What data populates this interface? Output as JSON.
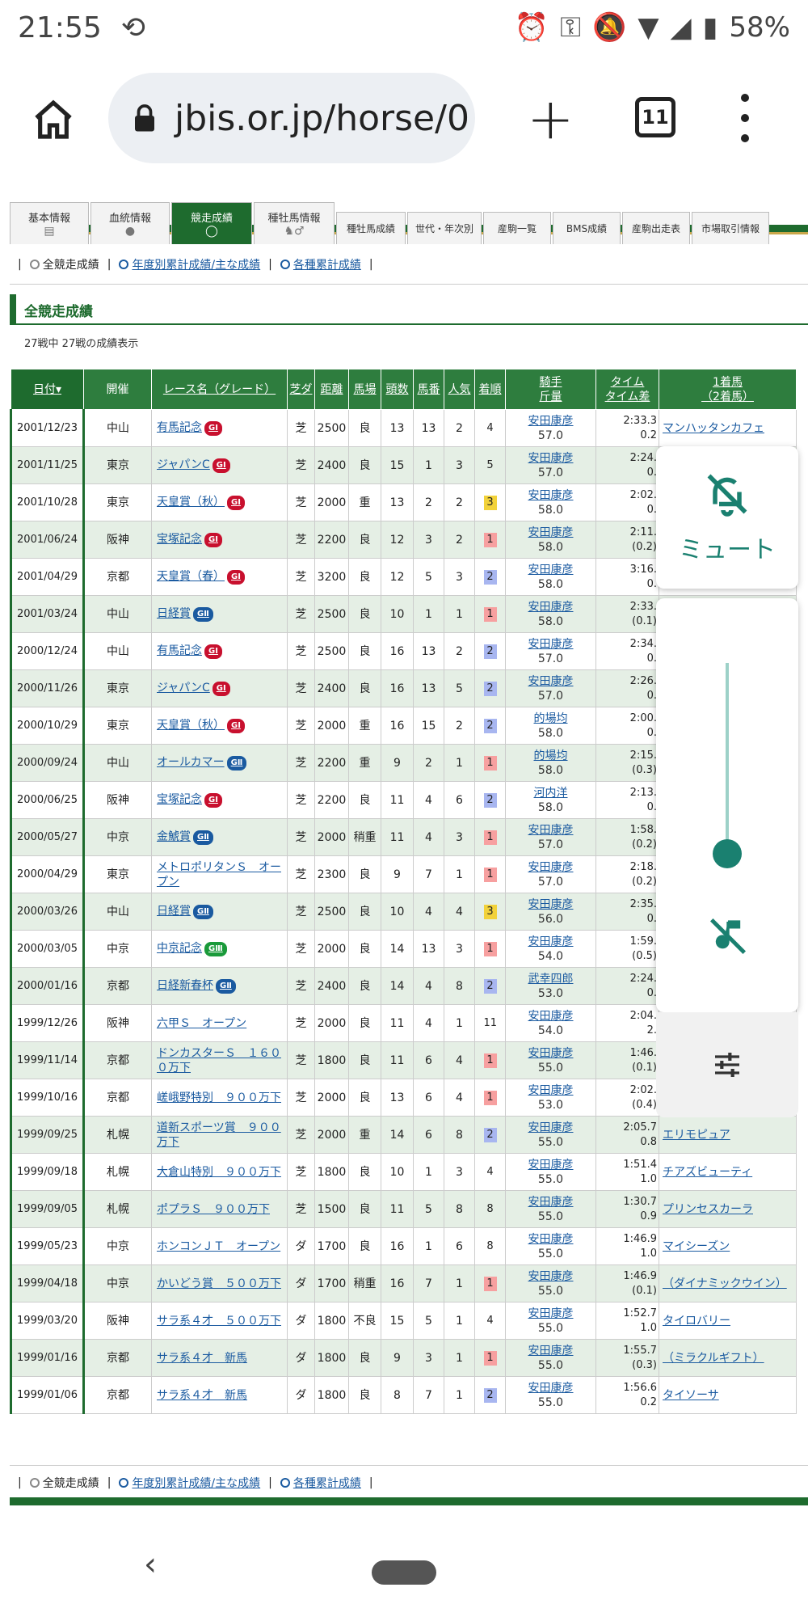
{
  "status": {
    "time": "21:55",
    "battery": "58%"
  },
  "browser": {
    "url": "jbis.or.jp/horse/0",
    "tab_count": "11"
  },
  "nav_tabs": [
    "基本情報",
    "血統情報",
    "競走成績",
    "種牡馬情報",
    "種牡馬成績",
    "世代・年次別",
    "産駒一覧",
    "BMS成績",
    "産駒出走表",
    "市場取引情報"
  ],
  "sublinks": [
    "全競走成績",
    "年度別累計成績/主な成績",
    "各種累計成績"
  ],
  "section_title": "全競走成績",
  "count_text": "27戦中 27戦の成績表示",
  "headers": {
    "date": "日付▾",
    "venue": "開催",
    "race": "レース名（グレード）",
    "surface": "芝ダ",
    "distance": "距離",
    "track": "馬場",
    "runners": "頭数",
    "number": "馬番",
    "pop": "人気",
    "place": "着順",
    "jockey": "騎手",
    "weight": "斤量",
    "time": "タイム",
    "diff": "タイム差",
    "winner": "1着馬",
    "second": "（2着馬）"
  },
  "rows": [
    {
      "date": "2001/12/23",
      "venue": "中山",
      "race": "有馬記念",
      "grade": "G1",
      "surface": "芝",
      "dist": "2500",
      "track": "良",
      "runners": "13",
      "num": "13",
      "pop": "2",
      "place": "4",
      "jockey": "安田康彦",
      "weight": "57.0",
      "time": "2:33.3",
      "diff": "0.2",
      "winner": "マンハッタンカフェ"
    },
    {
      "date": "2001/11/25",
      "venue": "東京",
      "race": "ジャパンC",
      "grade": "G1",
      "surface": "芝",
      "dist": "2400",
      "track": "良",
      "runners": "15",
      "num": "1",
      "pop": "3",
      "place": "5",
      "jockey": "安田康彦",
      "weight": "57.0",
      "time": "2:24.",
      "diff": "0.",
      "winner": ""
    },
    {
      "date": "2001/10/28",
      "venue": "東京",
      "race": "天皇賞（秋）",
      "grade": "G1",
      "surface": "芝",
      "dist": "2000",
      "track": "重",
      "runners": "13",
      "num": "2",
      "pop": "2",
      "place": "3",
      "jockey": "安田康彦",
      "weight": "58.0",
      "time": "2:02.",
      "diff": "0.",
      "winner": ""
    },
    {
      "date": "2001/06/24",
      "venue": "阪神",
      "race": "宝塚記念",
      "grade": "G1",
      "surface": "芝",
      "dist": "2200",
      "track": "良",
      "runners": "12",
      "num": "3",
      "pop": "2",
      "place": "1",
      "jockey": "安田康彦",
      "weight": "58.0",
      "time": "2:11.",
      "diff": "(0.2)",
      "winner": ""
    },
    {
      "date": "2001/04/29",
      "venue": "京都",
      "race": "天皇賞（春）",
      "grade": "G1",
      "surface": "芝",
      "dist": "3200",
      "track": "良",
      "runners": "12",
      "num": "5",
      "pop": "3",
      "place": "2",
      "jockey": "安田康彦",
      "weight": "58.0",
      "time": "3:16.",
      "diff": "0.",
      "winner": ""
    },
    {
      "date": "2001/03/24",
      "venue": "中山",
      "race": "日経賞",
      "grade": "G2",
      "surface": "芝",
      "dist": "2500",
      "track": "良",
      "runners": "10",
      "num": "1",
      "pop": "1",
      "place": "1",
      "jockey": "安田康彦",
      "weight": "58.0",
      "time": "2:33.",
      "diff": "(0.1)",
      "winner": ""
    },
    {
      "date": "2000/12/24",
      "venue": "中山",
      "race": "有馬記念",
      "grade": "G1",
      "surface": "芝",
      "dist": "2500",
      "track": "良",
      "runners": "16",
      "num": "13",
      "pop": "2",
      "place": "2",
      "jockey": "安田康彦",
      "weight": "57.0",
      "time": "2:34.",
      "diff": "0.",
      "winner": ""
    },
    {
      "date": "2000/11/26",
      "venue": "東京",
      "race": "ジャパンC",
      "grade": "G1",
      "surface": "芝",
      "dist": "2400",
      "track": "良",
      "runners": "16",
      "num": "13",
      "pop": "5",
      "place": "2",
      "jockey": "安田康彦",
      "weight": "57.0",
      "time": "2:26.",
      "diff": "0.",
      "winner": ""
    },
    {
      "date": "2000/10/29",
      "venue": "東京",
      "race": "天皇賞（秋）",
      "grade": "G1",
      "surface": "芝",
      "dist": "2000",
      "track": "重",
      "runners": "16",
      "num": "15",
      "pop": "2",
      "place": "2",
      "jockey": "的場均",
      "weight": "58.0",
      "time": "2:00.",
      "diff": "0.",
      "winner": ""
    },
    {
      "date": "2000/09/24",
      "venue": "中山",
      "race": "オールカマー",
      "grade": "G2",
      "surface": "芝",
      "dist": "2200",
      "track": "重",
      "runners": "9",
      "num": "2",
      "pop": "1",
      "place": "1",
      "jockey": "的場均",
      "weight": "58.0",
      "time": "2:15.",
      "diff": "(0.3)",
      "winner": ""
    },
    {
      "date": "2000/06/25",
      "venue": "阪神",
      "race": "宝塚記念",
      "grade": "G1",
      "surface": "芝",
      "dist": "2200",
      "track": "良",
      "runners": "11",
      "num": "4",
      "pop": "6",
      "place": "2",
      "jockey": "河内洋",
      "weight": "58.0",
      "time": "2:13.",
      "diff": "0.",
      "winner": ""
    },
    {
      "date": "2000/05/27",
      "venue": "中京",
      "race": "金鯱賞",
      "grade": "G2",
      "surface": "芝",
      "dist": "2000",
      "track": "稍重",
      "runners": "11",
      "num": "4",
      "pop": "3",
      "place": "1",
      "jockey": "安田康彦",
      "weight": "57.0",
      "time": "1:58.",
      "diff": "(0.2)",
      "winner": ""
    },
    {
      "date": "2000/04/29",
      "venue": "東京",
      "race": "メトロポリタンＳ　オープン",
      "grade": "",
      "surface": "芝",
      "dist": "2300",
      "track": "良",
      "runners": "9",
      "num": "7",
      "pop": "1",
      "place": "1",
      "jockey": "安田康彦",
      "weight": "57.0",
      "time": "2:18.",
      "diff": "(0.2)",
      "winner": ""
    },
    {
      "date": "2000/03/26",
      "venue": "中山",
      "race": "日経賞",
      "grade": "G2",
      "surface": "芝",
      "dist": "2500",
      "track": "良",
      "runners": "10",
      "num": "4",
      "pop": "4",
      "place": "3",
      "jockey": "安田康彦",
      "weight": "56.0",
      "time": "2:35.",
      "diff": "0.",
      "winner": ""
    },
    {
      "date": "2000/03/05",
      "venue": "中京",
      "race": "中京記念",
      "grade": "G3",
      "surface": "芝",
      "dist": "2000",
      "track": "良",
      "runners": "14",
      "num": "13",
      "pop": "3",
      "place": "1",
      "jockey": "安田康彦",
      "weight": "54.0",
      "time": "1:59.",
      "diff": "(0.5)",
      "winner": ""
    },
    {
      "date": "2000/01/16",
      "venue": "京都",
      "race": "日経新春杯",
      "grade": "G2",
      "surface": "芝",
      "dist": "2400",
      "track": "良",
      "runners": "14",
      "num": "4",
      "pop": "8",
      "place": "2",
      "jockey": "武幸四郎",
      "weight": "53.0",
      "time": "2:24.",
      "diff": "0.",
      "winner": ""
    },
    {
      "date": "1999/12/26",
      "venue": "阪神",
      "race": "六甲Ｓ　オープン",
      "grade": "",
      "surface": "芝",
      "dist": "2000",
      "track": "良",
      "runners": "11",
      "num": "4",
      "pop": "1",
      "place": "11",
      "jockey": "安田康彦",
      "weight": "54.0",
      "time": "2:04.",
      "diff": "2.",
      "winner": ""
    },
    {
      "date": "1999/11/14",
      "venue": "京都",
      "race": "ドンカスターＳ　１６００万下",
      "grade": "",
      "surface": "芝",
      "dist": "1800",
      "track": "良",
      "runners": "11",
      "num": "6",
      "pop": "4",
      "place": "1",
      "jockey": "安田康彦",
      "weight": "55.0",
      "time": "1:46.",
      "diff": "(0.1)",
      "winner": ""
    },
    {
      "date": "1999/10/16",
      "venue": "京都",
      "race": "嵯峨野特別　９００万下",
      "grade": "",
      "surface": "芝",
      "dist": "2000",
      "track": "良",
      "runners": "13",
      "num": "6",
      "pop": "4",
      "place": "1",
      "jockey": "安田康彦",
      "weight": "53.0",
      "time": "2:02.",
      "diff": "(0.4)",
      "winner": ""
    },
    {
      "date": "1999/09/25",
      "venue": "札幌",
      "race": "道新スポーツ賞　９００万下",
      "grade": "",
      "surface": "芝",
      "dist": "2000",
      "track": "重",
      "runners": "14",
      "num": "6",
      "pop": "8",
      "place": "2",
      "jockey": "安田康彦",
      "weight": "55.0",
      "time": "2:05.7",
      "diff": "0.8",
      "winner": "エリモピュア"
    },
    {
      "date": "1999/09/18",
      "venue": "札幌",
      "race": "大倉山特別　９００万下",
      "grade": "",
      "surface": "芝",
      "dist": "1800",
      "track": "良",
      "runners": "10",
      "num": "1",
      "pop": "3",
      "place": "4",
      "jockey": "安田康彦",
      "weight": "55.0",
      "time": "1:51.4",
      "diff": "1.0",
      "winner": "チアズビューティ"
    },
    {
      "date": "1999/09/05",
      "venue": "札幌",
      "race": "ポプラＳ　９００万下",
      "grade": "",
      "surface": "芝",
      "dist": "1500",
      "track": "良",
      "runners": "11",
      "num": "5",
      "pop": "8",
      "place": "8",
      "jockey": "安田康彦",
      "weight": "55.0",
      "time": "1:30.7",
      "diff": "0.9",
      "winner": "プリンセスカーラ"
    },
    {
      "date": "1999/05/23",
      "venue": "中京",
      "race": "ホンコンＪＴ　オープン",
      "grade": "",
      "surface": "ダ",
      "dist": "1700",
      "track": "良",
      "runners": "16",
      "num": "1",
      "pop": "6",
      "place": "8",
      "jockey": "安田康彦",
      "weight": "55.0",
      "time": "1:46.9",
      "diff": "1.0",
      "winner": "マイシーズン"
    },
    {
      "date": "1999/04/18",
      "venue": "中京",
      "race": "かいどう賞　５００万下",
      "grade": "",
      "surface": "ダ",
      "dist": "1700",
      "track": "稍重",
      "runners": "16",
      "num": "7",
      "pop": "1",
      "place": "1",
      "jockey": "安田康彦",
      "weight": "55.0",
      "time": "1:46.9",
      "diff": "(0.1)",
      "winner": "（ダイナミックウイン）"
    },
    {
      "date": "1999/03/20",
      "venue": "阪神",
      "race": "サラ系４才　５００万下",
      "grade": "",
      "surface": "ダ",
      "dist": "1800",
      "track": "不良",
      "runners": "15",
      "num": "5",
      "pop": "1",
      "place": "4",
      "jockey": "安田康彦",
      "weight": "55.0",
      "time": "1:52.7",
      "diff": "1.0",
      "winner": "タイロバリー"
    },
    {
      "date": "1999/01/16",
      "venue": "京都",
      "race": "サラ系４才　新馬",
      "grade": "",
      "surface": "ダ",
      "dist": "1800",
      "track": "良",
      "runners": "9",
      "num": "3",
      "pop": "1",
      "place": "1",
      "jockey": "安田康彦",
      "weight": "55.0",
      "time": "1:55.7",
      "diff": "(0.3)",
      "winner": "（ミラクルギフト）"
    },
    {
      "date": "1999/01/06",
      "venue": "京都",
      "race": "サラ系４才　新馬",
      "grade": "",
      "surface": "ダ",
      "dist": "1800",
      "track": "良",
      "runners": "8",
      "num": "7",
      "pop": "1",
      "place": "2",
      "jockey": "安田康彦",
      "weight": "55.0",
      "time": "1:56.6",
      "diff": "0.2",
      "winner": "タイソーサ"
    }
  ],
  "overlay": {
    "mute_label": "ミュート"
  },
  "colors": {
    "green": "#1e6b2e",
    "teal": "#1a8070",
    "link": "#1a5aa0"
  }
}
